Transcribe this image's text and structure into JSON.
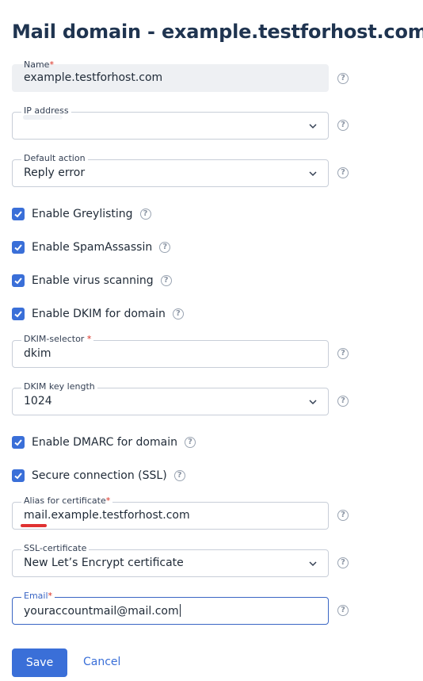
{
  "page": {
    "title": "Mail domain - example.testforhost.com"
  },
  "fields": {
    "name": {
      "label": "Name",
      "required_mark": "*",
      "value": "example.testforhost.com"
    },
    "ip_address": {
      "label": "IP address",
      "value": ""
    },
    "default_action": {
      "label": "Default action",
      "value": "Reply error"
    },
    "dkim_selector": {
      "label": "DKIM-selector",
      "required_mark": "*",
      "value": "dkim"
    },
    "dkim_key_length": {
      "label": "DKIM key length",
      "value": "1024"
    },
    "alias_cert": {
      "label": "Alias for certificate",
      "required_mark": "*",
      "value": "mail.example.testforhost.com"
    },
    "ssl_cert": {
      "label": "SSL-certificate",
      "value": "New Let’s Encrypt certificate"
    },
    "email": {
      "label": "Email",
      "required_mark": "*",
      "value": "youraccountmail@mail.com"
    }
  },
  "checkboxes": {
    "greylisting": {
      "label": "Enable Greylisting",
      "checked": true
    },
    "spamassassin": {
      "label": "Enable SpamAssassin",
      "checked": true
    },
    "virus_scanning": {
      "label": "Enable virus scanning",
      "checked": true
    },
    "dkim": {
      "label": "Enable DKIM for domain",
      "checked": true
    },
    "dmarc": {
      "label": "Enable DMARC for domain",
      "checked": true
    },
    "ssl": {
      "label": "Secure connection (SSL)",
      "checked": true
    }
  },
  "help_glyph": "?",
  "buttons": {
    "save": "Save",
    "cancel": "Cancel"
  },
  "icons": {
    "title_action": "link-icon",
    "dropdown": "chevron-down-icon",
    "help": "help-circle-icon",
    "check": "checkmark-icon"
  },
  "colors": {
    "accent": "#3a6fd8",
    "required": "#d92d20",
    "title": "#1f3450",
    "annotation": "#e03131"
  }
}
